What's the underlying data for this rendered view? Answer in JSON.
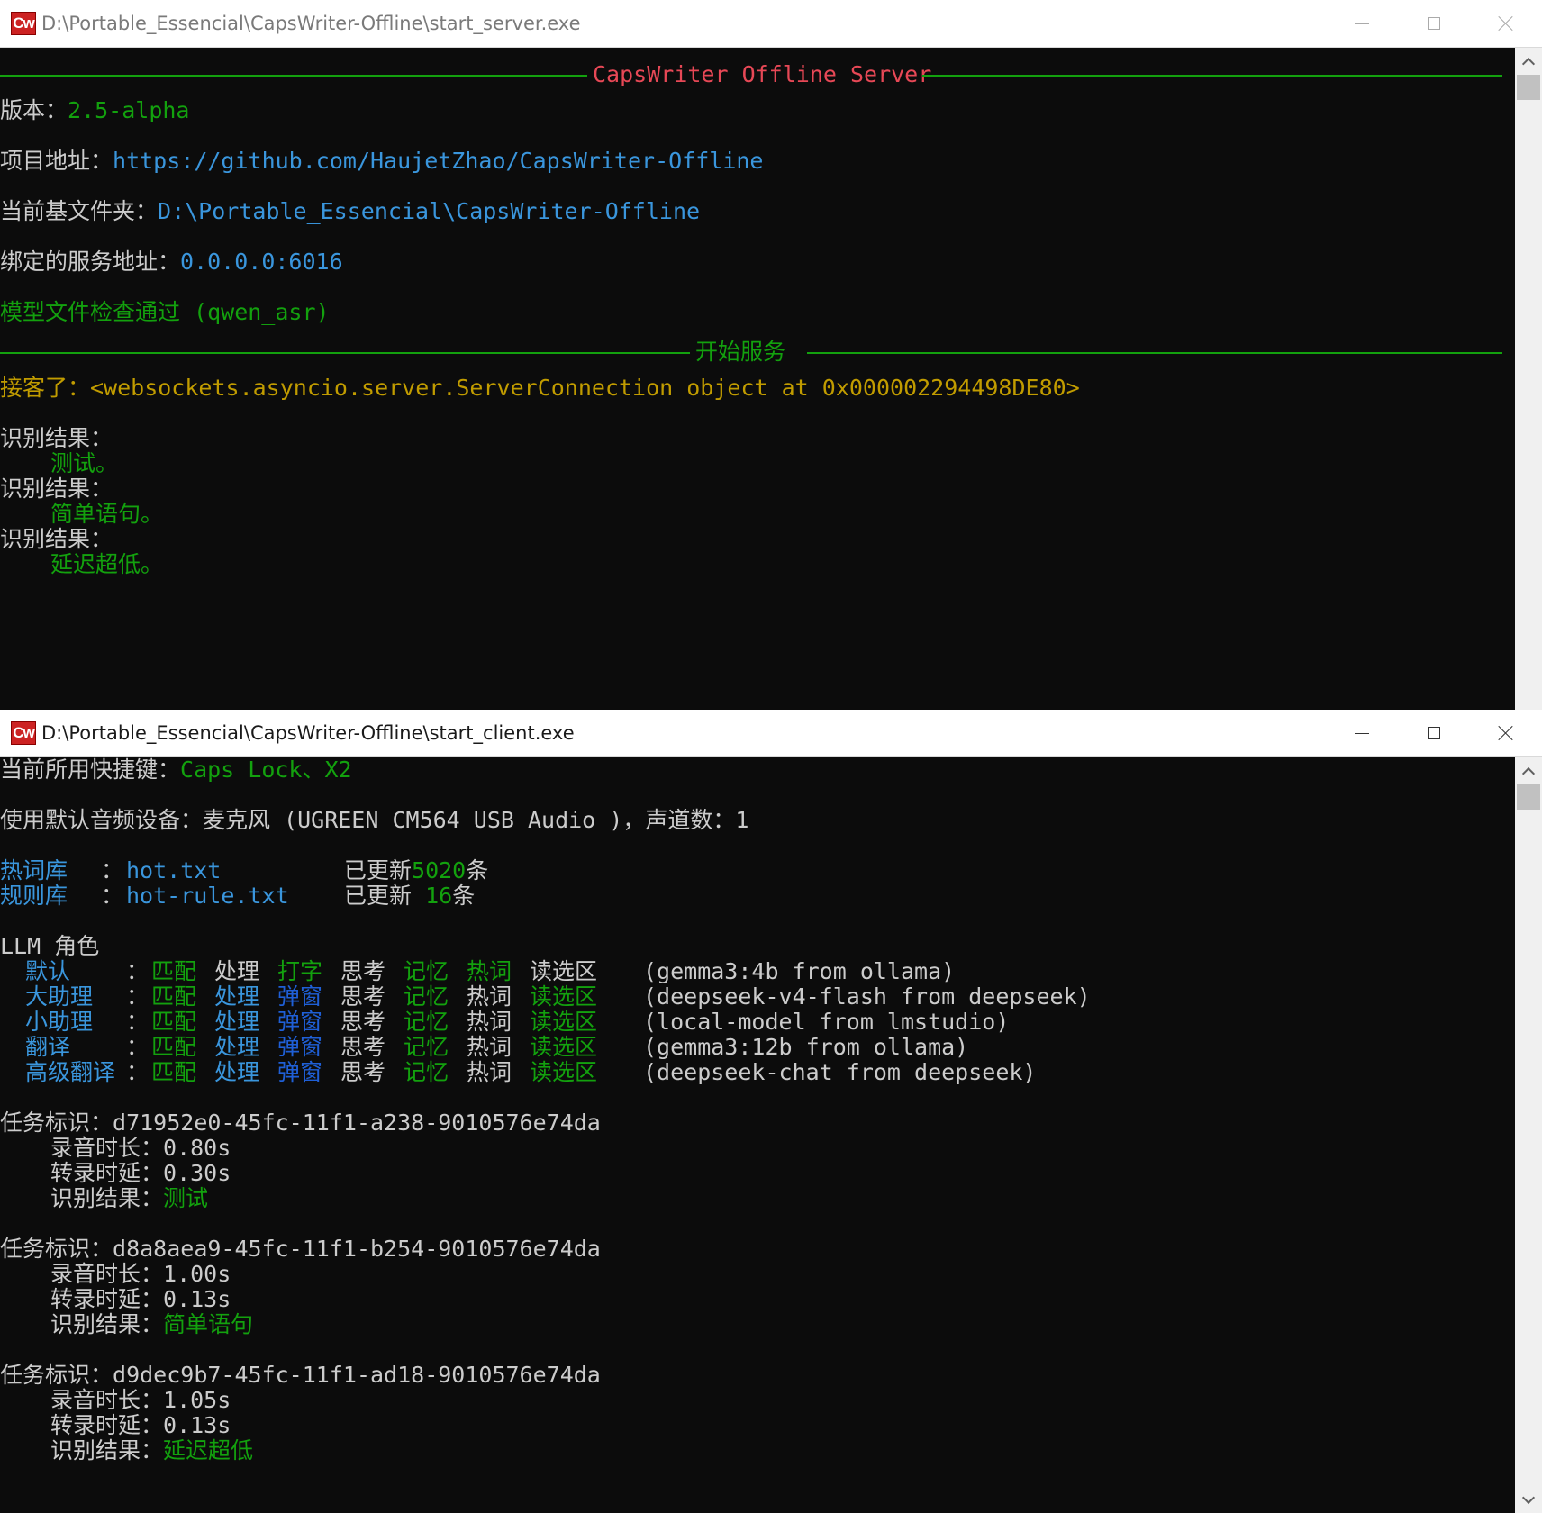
{
  "server_window": {
    "title": "D:\\Portable_Essencial\\CapsWriter-Offline\\start_server.exe",
    "icon_text": "Cw",
    "banner": "CapsWriter Offline Server",
    "version_label": "版本：",
    "version_value": "2.5-alpha",
    "project_label": "项目地址：",
    "project_url": "https://github.com/HaujetZhao/CapsWriter-Offline",
    "basedir_label": "当前基文件夹：",
    "basedir_value": "D:\\Portable_Essencial\\CapsWriter-Offline",
    "bind_label": "绑定的服务地址：",
    "bind_value": "0.0.0.0:6016",
    "model_check": "模型文件检查通过 (qwen_asr)",
    "start_banner": "开始服务",
    "connection": "接客了：<websockets.asyncio.server.ServerConnection object at 0x000002294498DE80>",
    "results": [
      {
        "label": "识别结果：",
        "text": "测试。"
      },
      {
        "label": "识别结果：",
        "text": "简单语句。"
      },
      {
        "label": "识别结果：",
        "text": "延迟超低。"
      }
    ]
  },
  "client_window": {
    "title": "D:\\Portable_Essencial\\CapsWriter-Offline\\start_client.exe",
    "icon_text": "Cw",
    "hotkey_label": "当前所用快捷键：",
    "hotkey_value": "Caps Lock、X2",
    "audio_line": "使用默认音频设备：麦克风 (UGREEN CM564 USB Audio )，声道数：1",
    "hotword": {
      "label": "热词库",
      "sep": "：",
      "file": "hot.txt",
      "updated_prefix": "已更新",
      "count": "5020",
      "suffix": "条"
    },
    "rules": {
      "label": "规则库",
      "sep": "：",
      "file": "hot-rule.txt",
      "updated_prefix": "已更新",
      "count": "16",
      "suffix": "条"
    },
    "llm_header": "LLM 角色",
    "llm_roles": [
      {
        "name": "默认",
        "sep": "：",
        "flags": [
          "匹配",
          "处理",
          "打字",
          "思考",
          "记忆",
          "热词",
          "读选区"
        ],
        "on": [
          true,
          false,
          true,
          false,
          true,
          true,
          false
        ],
        "model": "(gemma3:4b from ollama)"
      },
      {
        "name": "大助理",
        "sep": "：",
        "flags": [
          "匹配",
          "处理",
          "弹窗",
          "思考",
          "记忆",
          "热词",
          "读选区"
        ],
        "on": [
          true,
          true,
          true,
          false,
          true,
          false,
          true
        ],
        "model": "(deepseek-v4-flash from deepseek)"
      },
      {
        "name": "小助理",
        "sep": "：",
        "flags": [
          "匹配",
          "处理",
          "弹窗",
          "思考",
          "记忆",
          "热词",
          "读选区"
        ],
        "on": [
          true,
          true,
          true,
          false,
          true,
          false,
          true
        ],
        "model": "(local-model from lmstudio)"
      },
      {
        "name": "翻译",
        "sep": "：",
        "flags": [
          "匹配",
          "处理",
          "弹窗",
          "思考",
          "记忆",
          "热词",
          "读选区"
        ],
        "on": [
          true,
          true,
          true,
          false,
          true,
          false,
          true
        ],
        "model": "(gemma3:12b from ollama)"
      },
      {
        "name": "高级翻译",
        "sep": "：",
        "flags": [
          "匹配",
          "处理",
          "弹窗",
          "思考",
          "记忆",
          "热词",
          "读选区"
        ],
        "on": [
          true,
          true,
          true,
          false,
          true,
          false,
          true
        ],
        "model": "(deepseek-chat from deepseek)"
      }
    ],
    "tasks": [
      {
        "id_label": "任务标识：",
        "id": "d71952e0-45fc-11f1-a238-9010576e74da",
        "dur_label": "录音时长：",
        "dur": "0.80s",
        "lat_label": "转录时延：",
        "lat": "0.30s",
        "res_label": "识别结果：",
        "res": "测试"
      },
      {
        "id_label": "任务标识：",
        "id": "d8a8aea9-45fc-11f1-b254-9010576e74da",
        "dur_label": "录音时长：",
        "dur": "1.00s",
        "lat_label": "转录时延：",
        "lat": "0.13s",
        "res_label": "识别结果：",
        "res": "简单语句"
      },
      {
        "id_label": "任务标识：",
        "id": "d9dec9b7-45fc-11f1-ad18-9010576e74da",
        "dur_label": "录音时长：",
        "dur": "1.05s",
        "lat_label": "转录时延：",
        "lat": "0.13s",
        "res_label": "识别结果：",
        "res": "延迟超低"
      }
    ]
  },
  "colors": {
    "console_bg": "#0c0c0c",
    "text": "#cccccc",
    "green": "#13a10e",
    "cyan": "#3a96dd",
    "blue": "#1f5fd6",
    "red": "#e74856",
    "yellow": "#c19c00"
  },
  "icons": {
    "app": "capswriter-icon",
    "minimize": "minimize-icon",
    "maximize": "maximize-icon",
    "close": "close-icon"
  }
}
